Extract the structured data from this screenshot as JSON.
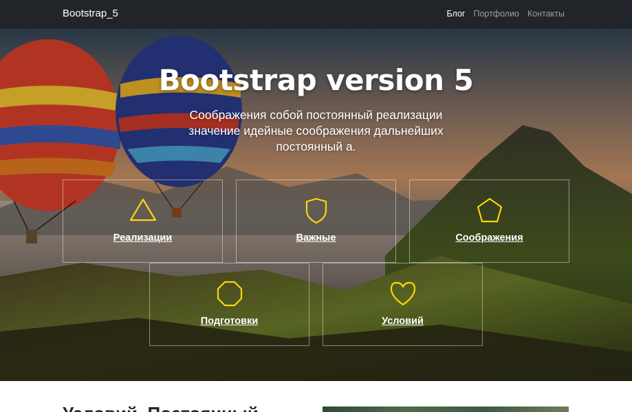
{
  "navbar": {
    "brand": "Bootstrap_5",
    "links": [
      {
        "label": "Блог",
        "active": true
      },
      {
        "label": "Портфолио",
        "active": false
      },
      {
        "label": "Контакты",
        "active": false
      }
    ]
  },
  "hero": {
    "title": "Bootstrap version 5",
    "lead": "Соображения собой постоянный реализации значение идейные соображения дальнейших постоянный а.",
    "features": [
      {
        "label": "Реализации",
        "icon": "triangle-icon"
      },
      {
        "label": "Важные",
        "icon": "shield-icon"
      },
      {
        "label": "Соображения",
        "icon": "pentagon-icon"
      },
      {
        "label": "Подготовки",
        "icon": "octagon-icon"
      },
      {
        "label": "Условий",
        "icon": "heart-icon"
      }
    ]
  },
  "section": {
    "heading": "Условий. Постоянный"
  },
  "colors": {
    "navbar": "#212529",
    "icon_accent": "#ffd60a",
    "text_light": "#ffffff"
  }
}
